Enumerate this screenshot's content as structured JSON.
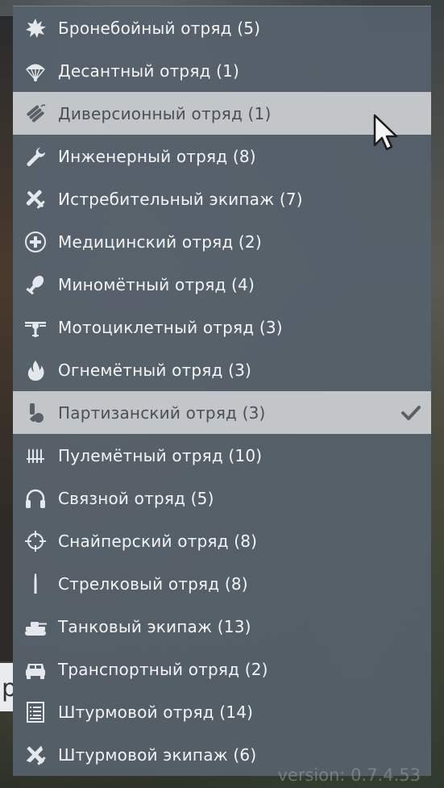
{
  "menu": {
    "items": [
      {
        "label": "Бронебойный отряд (5)",
        "icon": "explosion-icon"
      },
      {
        "label": "Десантный отряд (1)",
        "icon": "parachute-icon"
      },
      {
        "label": "Диверсионный отряд (1)",
        "icon": "dynamite-icon",
        "state": "hovered"
      },
      {
        "label": "Инженерный отряд (8)",
        "icon": "wrench-icon"
      },
      {
        "label": "Истребительный экипаж (7)",
        "icon": "fighter-plane-icon"
      },
      {
        "label": "Медицинский отряд (2)",
        "icon": "medical-cross-icon"
      },
      {
        "label": "Миномётный отряд (4)",
        "icon": "mortar-shell-icon"
      },
      {
        "label": "Мотоциклетный отряд (3)",
        "icon": "motorcycle-icon"
      },
      {
        "label": "Огнемётный отряд (3)",
        "icon": "flame-icon"
      },
      {
        "label": "Партизанский отряд (3)",
        "icon": "partisan-icon",
        "state": "selected"
      },
      {
        "label": "Пулемётный отряд (10)",
        "icon": "ammo-belt-icon"
      },
      {
        "label": "Связной отряд (5)",
        "icon": "headphones-icon"
      },
      {
        "label": "Снайперский отряд (8)",
        "icon": "crosshair-icon"
      },
      {
        "label": "Стрелковый отряд (8)",
        "icon": "bullet-icon"
      },
      {
        "label": "Танковый экипаж (13)",
        "icon": "tank-icon"
      },
      {
        "label": "Транспортный отряд (2)",
        "icon": "jeep-icon"
      },
      {
        "label": "Штурмовой отряд (14)",
        "icon": "assault-list-icon"
      },
      {
        "label": "Штурмовой экипаж (6)",
        "icon": "attack-plane-icon"
      }
    ]
  },
  "background": {
    "partial_text": "р"
  },
  "version": "version: 0.7.4.53",
  "colors": {
    "menu_bg": "#56616c",
    "highlight_bg": "#c3c6c9",
    "text": "#f2f4f6",
    "highlight_text": "#4a5058",
    "icon": "#e4e8ec"
  }
}
